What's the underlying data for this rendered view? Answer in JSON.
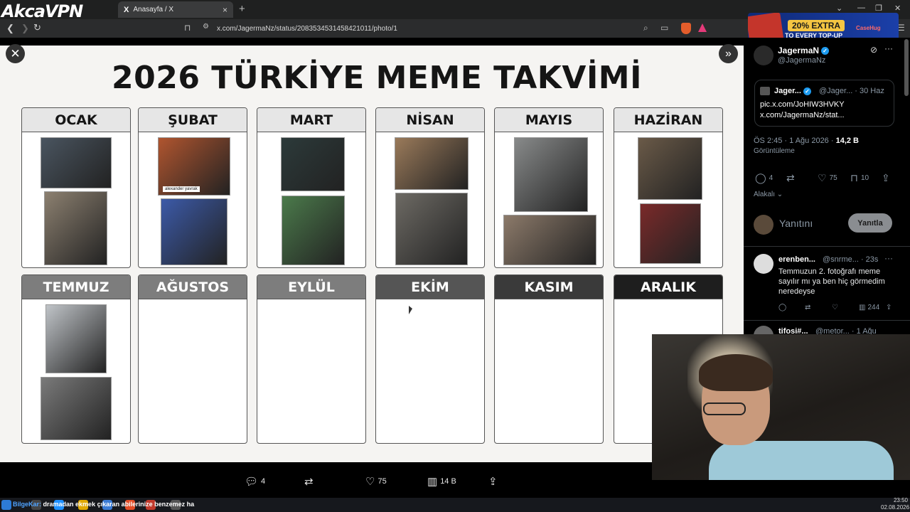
{
  "browser": {
    "brand": "AkcaVPN",
    "tab_title": "Anasayfa / X",
    "tab_logo": "X",
    "url": "x.com/JagermaNz/status/2083534531458421011/photo/1"
  },
  "ad": {
    "badge": "20% EXTRA",
    "text": "TO EVERY TOP-UP",
    "logo": "CaseHug"
  },
  "viewer": {
    "title": "2026 TÜRKİYE MEME TAKVİMİ",
    "close_glyph": "✕",
    "next_glyph": "»",
    "months": [
      {
        "name": "OCAK",
        "photos": 2,
        "header_color": "#e6e6e6"
      },
      {
        "name": "ŞUBAT",
        "photos": 2,
        "header_color": "#e6e6e6"
      },
      {
        "name": "MART",
        "photos": 2,
        "header_color": "#e6e6e6"
      },
      {
        "name": "NİSAN",
        "photos": 2,
        "header_color": "#e6e6e6"
      },
      {
        "name": "MAYIS",
        "photos": 2,
        "header_color": "#e6e6e6"
      },
      {
        "name": "HAZİRAN",
        "photos": 2,
        "header_color": "#e6e6e6"
      },
      {
        "name": "TEMMUZ",
        "photos": 2,
        "header_color": "#7d7d7d"
      },
      {
        "name": "AĞUSTOS",
        "photos": 0,
        "header_color": "#7d7d7d"
      },
      {
        "name": "EYLÜL",
        "photos": 0,
        "header_color": "#7d7d7d"
      },
      {
        "name": "EKİM",
        "photos": 0,
        "header_color": "#555555"
      },
      {
        "name": "KASIM",
        "photos": 0,
        "header_color": "#3a3a3a"
      },
      {
        "name": "ARALIK",
        "photos": 0,
        "header_color": "#1e1e1e"
      }
    ],
    "photo_caption": "alexander yavrak",
    "actions": {
      "replies": "4",
      "likes": "75",
      "views": "14 B"
    }
  },
  "tweet": {
    "author": "JagermaN",
    "handle": "@JagermaNz",
    "quote_author": "Jager...",
    "quote_handle": "@Jager... · 30 Haz",
    "quote_line1": "pic.x.com/JoHIW3HVKY",
    "quote_line2": "x.com/JagermaNz/stat...",
    "time": "ÖS 2:45 · 1 Ağu 2026 · ",
    "views_count": "14,2 B",
    "views_label": "Görüntüleme",
    "replies": "4",
    "likes": "75",
    "bookmarks": "10",
    "related": "Alakalı",
    "reply_placeholder": "Yanıtını",
    "reply_button": "Yanıtla"
  },
  "replies": [
    {
      "name": "erenben...",
      "meta": "@snrme... · 23s",
      "text": "Temmuzun 2. fotoğrafı meme sayılır mı ya ben hiç görmedim neredeyse",
      "views": "244"
    },
    {
      "name": "tifosi#...",
      "meta": "@metor... · 1 Ağu"
    }
  ],
  "taskbar": {
    "ticker_name": "BilgeKar:",
    "ticker_text": "dramadan ekmek çıkaran abilerinize benzemez ha",
    "time": "23:50",
    "date": "02.08.2026"
  }
}
